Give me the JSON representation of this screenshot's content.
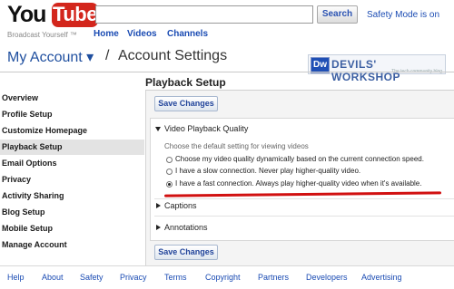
{
  "header": {
    "logo_you": "You",
    "logo_tube": "Tube",
    "tagline": "Broadcast Yourself ™",
    "search_value": "",
    "search_button": "Search",
    "safety_text": "Safety Mode is on",
    "nav": [
      "Home",
      "Videos",
      "Channels"
    ]
  },
  "titlebar": {
    "my_account": "My Account ▾",
    "separator": "/",
    "page_title": "Account Settings",
    "watermark_badge": "Dw",
    "watermark_text": "DEVILS' WORKSHOP",
    "watermark_sub": "The tech community blog"
  },
  "section_title": "Playback Setup",
  "sidebar": {
    "items": [
      {
        "label": "Overview"
      },
      {
        "label": "Profile Setup"
      },
      {
        "label": "Customize Homepage"
      },
      {
        "label": "Playback Setup"
      },
      {
        "label": "Email Options"
      },
      {
        "label": "Privacy"
      },
      {
        "label": "Activity Sharing"
      },
      {
        "label": "Blog Setup"
      },
      {
        "label": "Mobile Setup"
      },
      {
        "label": "Manage Account"
      }
    ],
    "active_index": 3
  },
  "content": {
    "save_top": "Save Changes",
    "save_bottom": "Save Changes",
    "quality_title": "Video Playback Quality",
    "quality_desc": "Choose the default setting for viewing videos",
    "options": [
      {
        "label": "Choose my video quality dynamically based on the current connection speed.",
        "selected": false
      },
      {
        "label": "I have a slow connection. Never play higher-quality video.",
        "selected": false
      },
      {
        "label": "I have a fast connection. Always play higher-quality video when it's available.",
        "selected": true
      }
    ],
    "captions": "Captions",
    "annotations": "Annotations"
  },
  "footer": {
    "links": [
      "Help",
      "About",
      "Safety",
      "Privacy",
      "Terms",
      "Copyright",
      "Partners",
      "Developers",
      "Advertising"
    ]
  },
  "colors": {
    "link_blue": "#1a4bb3",
    "brand_red": "#d3261c",
    "highlight_red": "#d11010"
  }
}
